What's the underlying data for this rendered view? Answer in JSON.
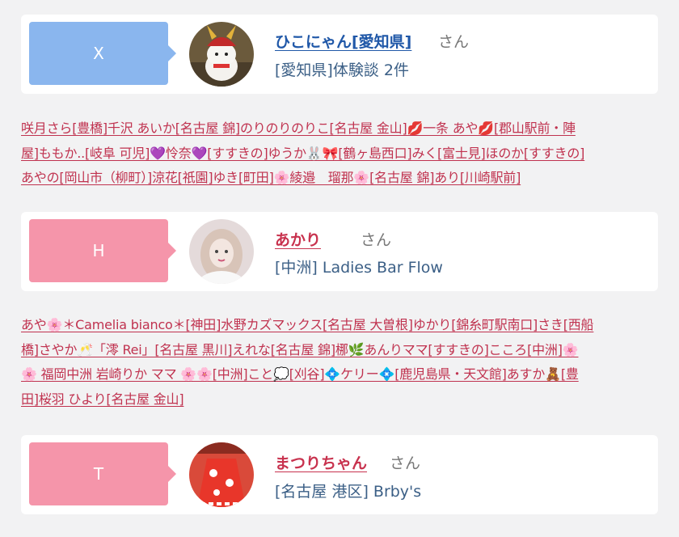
{
  "cards": [
    {
      "badge": "X",
      "badge_color": "#8ab6ee",
      "name": "ひこにゃん[愛知県]",
      "name_color": "#2058a8",
      "suffix": "さん",
      "subtitle": "[愛知県]体験談 2件",
      "avatar_icon": "mascot-samurai-cat-avatar"
    },
    {
      "badge": "H",
      "badge_color": "#f595aa",
      "name": "あかり",
      "name_color": "#c8324e",
      "suffix": "さん",
      "subtitle": "[中洲] Ladies Bar Flow",
      "avatar_icon": "woman-portrait-avatar"
    },
    {
      "badge": "T",
      "badge_color": "#f595aa",
      "name": "まつりちゃん",
      "name_color": "#c8324e",
      "suffix": "さん",
      "subtitle": "[名古屋 港区] Brby's",
      "avatar_icon": "red-festival-costume-avatar"
    }
  ],
  "link_groups": [
    [
      "咲月さら[豊橋]千沢 あいか[名古屋 錦]のりのりのりこ[名古屋 金山]💋一条 あや💋[郡山駅前・陣",
      "屋]ももか..[岐阜 可児]💜怜奈💜[すすきの]ゆうか🐰🎀[鶴ヶ島西口]みく[富士見]ほのか[すすきの]",
      "あやの[岡山市（柳町）]涼花[祇園]ゆき[町田]🌸綾邉　瑠那🌸[名古屋 錦]あり[川崎駅前]"
    ],
    [
      "あや🌸＊Camelia bianco＊[神田]水野カズマックス[名古屋 大曽根]ゆかり[錦糸町駅南口]さき[西船",
      "橋]さやか🥂「澪 Rei」[名古屋 黒川]えれな[名古屋 錦]梛🌿あんりママ[すすきの]こころ[中洲]🌸",
      "🌸 福岡中洲 岩崎りか ママ 🌸🌸[中洲]こと💭[刈谷]💠ケリー💠[鹿児島県・天文館]あすか🧸[豊",
      "田]桜羽 ひより[名古屋 金山]"
    ]
  ]
}
